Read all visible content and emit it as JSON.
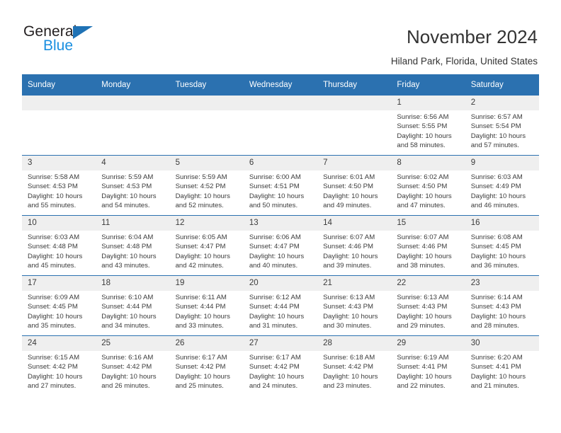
{
  "brand": {
    "name_part1": "General",
    "name_part2": "Blue",
    "triangle_color": "#1f72b5",
    "blue_text_color": "#1a8fe0"
  },
  "header": {
    "title": "November 2024",
    "subtitle": "Hiland Park, Florida, United States"
  },
  "theme": {
    "header_bg": "#2b71b0",
    "daynum_bg": "#efefef",
    "row_border": "#2b71b0",
    "text": "#3b3b3b"
  },
  "weekday_headers": [
    "Sunday",
    "Monday",
    "Tuesday",
    "Wednesday",
    "Thursday",
    "Friday",
    "Saturday"
  ],
  "labels": {
    "sunrise_prefix": "Sunrise:",
    "sunset_prefix": "Sunset:",
    "daylight_prefix": "Daylight:"
  },
  "calendar_data": {
    "month": "November",
    "year": 2024,
    "location": "Hiland Park, Florida, United States",
    "weeks": [
      [
        {
          "empty": true
        },
        {
          "empty": true
        },
        {
          "empty": true
        },
        {
          "empty": true
        },
        {
          "empty": true
        },
        {
          "day": "1",
          "sunrise": "Sunrise: 6:56 AM",
          "sunset": "Sunset: 5:55 PM",
          "daylight_l1": "Daylight: 10 hours",
          "daylight_l2": "and 58 minutes."
        },
        {
          "day": "2",
          "sunrise": "Sunrise: 6:57 AM",
          "sunset": "Sunset: 5:54 PM",
          "daylight_l1": "Daylight: 10 hours",
          "daylight_l2": "and 57 minutes."
        }
      ],
      [
        {
          "day": "3",
          "sunrise": "Sunrise: 5:58 AM",
          "sunset": "Sunset: 4:53 PM",
          "daylight_l1": "Daylight: 10 hours",
          "daylight_l2": "and 55 minutes."
        },
        {
          "day": "4",
          "sunrise": "Sunrise: 5:59 AM",
          "sunset": "Sunset: 4:53 PM",
          "daylight_l1": "Daylight: 10 hours",
          "daylight_l2": "and 54 minutes."
        },
        {
          "day": "5",
          "sunrise": "Sunrise: 5:59 AM",
          "sunset": "Sunset: 4:52 PM",
          "daylight_l1": "Daylight: 10 hours",
          "daylight_l2": "and 52 minutes."
        },
        {
          "day": "6",
          "sunrise": "Sunrise: 6:00 AM",
          "sunset": "Sunset: 4:51 PM",
          "daylight_l1": "Daylight: 10 hours",
          "daylight_l2": "and 50 minutes."
        },
        {
          "day": "7",
          "sunrise": "Sunrise: 6:01 AM",
          "sunset": "Sunset: 4:50 PM",
          "daylight_l1": "Daylight: 10 hours",
          "daylight_l2": "and 49 minutes."
        },
        {
          "day": "8",
          "sunrise": "Sunrise: 6:02 AM",
          "sunset": "Sunset: 4:50 PM",
          "daylight_l1": "Daylight: 10 hours",
          "daylight_l2": "and 47 minutes."
        },
        {
          "day": "9",
          "sunrise": "Sunrise: 6:03 AM",
          "sunset": "Sunset: 4:49 PM",
          "daylight_l1": "Daylight: 10 hours",
          "daylight_l2": "and 46 minutes."
        }
      ],
      [
        {
          "day": "10",
          "sunrise": "Sunrise: 6:03 AM",
          "sunset": "Sunset: 4:48 PM",
          "daylight_l1": "Daylight: 10 hours",
          "daylight_l2": "and 45 minutes."
        },
        {
          "day": "11",
          "sunrise": "Sunrise: 6:04 AM",
          "sunset": "Sunset: 4:48 PM",
          "daylight_l1": "Daylight: 10 hours",
          "daylight_l2": "and 43 minutes."
        },
        {
          "day": "12",
          "sunrise": "Sunrise: 6:05 AM",
          "sunset": "Sunset: 4:47 PM",
          "daylight_l1": "Daylight: 10 hours",
          "daylight_l2": "and 42 minutes."
        },
        {
          "day": "13",
          "sunrise": "Sunrise: 6:06 AM",
          "sunset": "Sunset: 4:47 PM",
          "daylight_l1": "Daylight: 10 hours",
          "daylight_l2": "and 40 minutes."
        },
        {
          "day": "14",
          "sunrise": "Sunrise: 6:07 AM",
          "sunset": "Sunset: 4:46 PM",
          "daylight_l1": "Daylight: 10 hours",
          "daylight_l2": "and 39 minutes."
        },
        {
          "day": "15",
          "sunrise": "Sunrise: 6:07 AM",
          "sunset": "Sunset: 4:46 PM",
          "daylight_l1": "Daylight: 10 hours",
          "daylight_l2": "and 38 minutes."
        },
        {
          "day": "16",
          "sunrise": "Sunrise: 6:08 AM",
          "sunset": "Sunset: 4:45 PM",
          "daylight_l1": "Daylight: 10 hours",
          "daylight_l2": "and 36 minutes."
        }
      ],
      [
        {
          "day": "17",
          "sunrise": "Sunrise: 6:09 AM",
          "sunset": "Sunset: 4:45 PM",
          "daylight_l1": "Daylight: 10 hours",
          "daylight_l2": "and 35 minutes."
        },
        {
          "day": "18",
          "sunrise": "Sunrise: 6:10 AM",
          "sunset": "Sunset: 4:44 PM",
          "daylight_l1": "Daylight: 10 hours",
          "daylight_l2": "and 34 minutes."
        },
        {
          "day": "19",
          "sunrise": "Sunrise: 6:11 AM",
          "sunset": "Sunset: 4:44 PM",
          "daylight_l1": "Daylight: 10 hours",
          "daylight_l2": "and 33 minutes."
        },
        {
          "day": "20",
          "sunrise": "Sunrise: 6:12 AM",
          "sunset": "Sunset: 4:44 PM",
          "daylight_l1": "Daylight: 10 hours",
          "daylight_l2": "and 31 minutes."
        },
        {
          "day": "21",
          "sunrise": "Sunrise: 6:13 AM",
          "sunset": "Sunset: 4:43 PM",
          "daylight_l1": "Daylight: 10 hours",
          "daylight_l2": "and 30 minutes."
        },
        {
          "day": "22",
          "sunrise": "Sunrise: 6:13 AM",
          "sunset": "Sunset: 4:43 PM",
          "daylight_l1": "Daylight: 10 hours",
          "daylight_l2": "and 29 minutes."
        },
        {
          "day": "23",
          "sunrise": "Sunrise: 6:14 AM",
          "sunset": "Sunset: 4:43 PM",
          "daylight_l1": "Daylight: 10 hours",
          "daylight_l2": "and 28 minutes."
        }
      ],
      [
        {
          "day": "24",
          "sunrise": "Sunrise: 6:15 AM",
          "sunset": "Sunset: 4:42 PM",
          "daylight_l1": "Daylight: 10 hours",
          "daylight_l2": "and 27 minutes."
        },
        {
          "day": "25",
          "sunrise": "Sunrise: 6:16 AM",
          "sunset": "Sunset: 4:42 PM",
          "daylight_l1": "Daylight: 10 hours",
          "daylight_l2": "and 26 minutes."
        },
        {
          "day": "26",
          "sunrise": "Sunrise: 6:17 AM",
          "sunset": "Sunset: 4:42 PM",
          "daylight_l1": "Daylight: 10 hours",
          "daylight_l2": "and 25 minutes."
        },
        {
          "day": "27",
          "sunrise": "Sunrise: 6:17 AM",
          "sunset": "Sunset: 4:42 PM",
          "daylight_l1": "Daylight: 10 hours",
          "daylight_l2": "and 24 minutes."
        },
        {
          "day": "28",
          "sunrise": "Sunrise: 6:18 AM",
          "sunset": "Sunset: 4:42 PM",
          "daylight_l1": "Daylight: 10 hours",
          "daylight_l2": "and 23 minutes."
        },
        {
          "day": "29",
          "sunrise": "Sunrise: 6:19 AM",
          "sunset": "Sunset: 4:41 PM",
          "daylight_l1": "Daylight: 10 hours",
          "daylight_l2": "and 22 minutes."
        },
        {
          "day": "30",
          "sunrise": "Sunrise: 6:20 AM",
          "sunset": "Sunset: 4:41 PM",
          "daylight_l1": "Daylight: 10 hours",
          "daylight_l2": "and 21 minutes."
        }
      ]
    ]
  }
}
